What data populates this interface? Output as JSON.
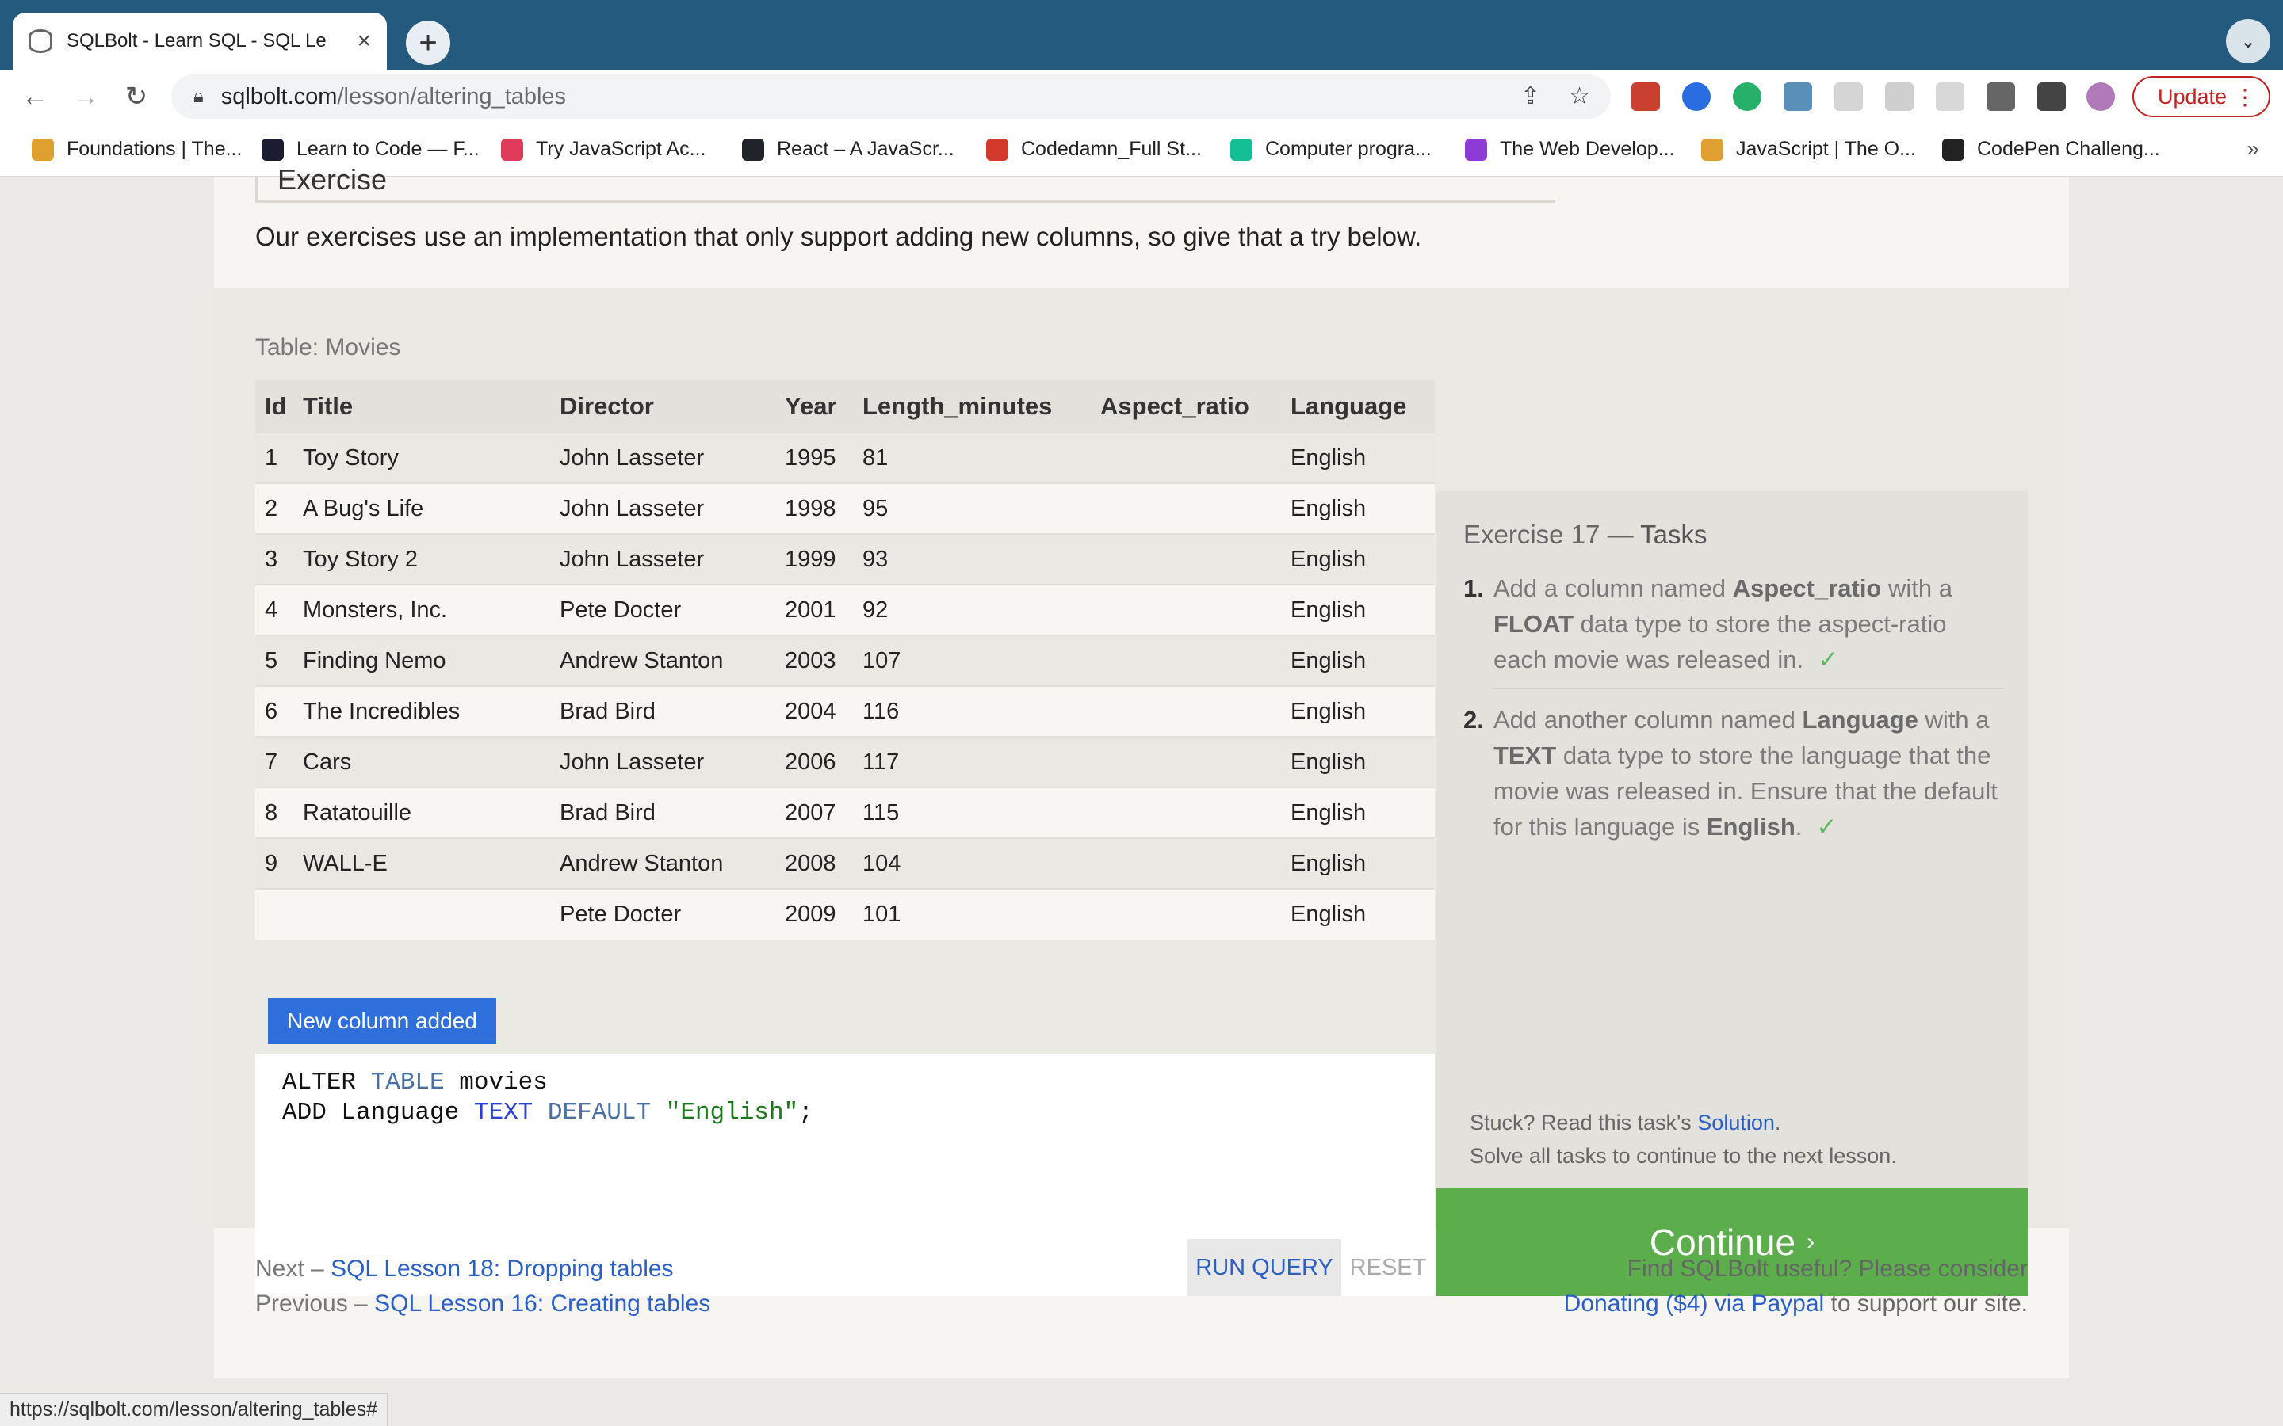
{
  "browser": {
    "tab_title": "SQLBolt - Learn SQL - SQL Le",
    "new_tab": "+",
    "url_host": "sqlbolt.com",
    "url_path": "/lesson/altering_tables",
    "update_label": "Update",
    "bookmarks": [
      {
        "label": "Foundations | The...",
        "color": "#e0a030"
      },
      {
        "label": "Learn to Code — F...",
        "color": "#1b1b32"
      },
      {
        "label": "Try JavaScript Ac...",
        "color": "#e03a5a"
      },
      {
        "label": "React – A JavaScr...",
        "color": "#20232a"
      },
      {
        "label": "Codedamn_Full St...",
        "color": "#d33a2c"
      },
      {
        "label": "Computer progra...",
        "color": "#14bf96"
      },
      {
        "label": "The Web Develop...",
        "color": "#8e3ad6"
      },
      {
        "label": "JavaScript | The O...",
        "color": "#e0a030"
      },
      {
        "label": "CodePen Challeng...",
        "color": "#222222"
      }
    ],
    "status_url": "https://sqlbolt.com/lesson/altering_tables#"
  },
  "lesson": {
    "box_heading": "Exercise",
    "intro": "Our exercises use an implementation that only support adding new columns, so give that a try below."
  },
  "table": {
    "caption": "Table: Movies",
    "columns": [
      "Id",
      "Title",
      "Director",
      "Year",
      "Length_minutes",
      "Aspect_ratio",
      "Language"
    ],
    "rows": [
      [
        "1",
        "Toy Story",
        "John Lasseter",
        "1995",
        "81",
        "",
        "English"
      ],
      [
        "2",
        "A Bug's Life",
        "John Lasseter",
        "1998",
        "95",
        "",
        "English"
      ],
      [
        "3",
        "Toy Story 2",
        "John Lasseter",
        "1999",
        "93",
        "",
        "English"
      ],
      [
        "4",
        "Monsters, Inc.",
        "Pete Docter",
        "2001",
        "92",
        "",
        "English"
      ],
      [
        "5",
        "Finding Nemo",
        "Andrew Stanton",
        "2003",
        "107",
        "",
        "English"
      ],
      [
        "6",
        "The Incredibles",
        "Brad Bird",
        "2004",
        "116",
        "",
        "English"
      ],
      [
        "7",
        "Cars",
        "John Lasseter",
        "2006",
        "117",
        "",
        "English"
      ],
      [
        "8",
        "Ratatouille",
        "Brad Bird",
        "2007",
        "115",
        "",
        "English"
      ],
      [
        "9",
        "WALL-E",
        "Andrew Stanton",
        "2008",
        "104",
        "",
        "English"
      ],
      [
        "",
        "",
        "Pete Docter",
        "2009",
        "101",
        "",
        "English"
      ]
    ]
  },
  "toast": "New column added",
  "editor": {
    "line1": [
      "ALTER",
      "TABLE",
      "movies"
    ],
    "line2": [
      "ADD",
      "Language",
      "TEXT",
      "DEFAULT",
      "\"English\"",
      ";"
    ],
    "run_label": "RUN QUERY",
    "reset_label": "RESET"
  },
  "tasks": {
    "title_prefix": "Exercise 17 —",
    "title_suffix": "Tasks",
    "items": [
      {
        "num": "1.",
        "a": "Add a column named ",
        "b": "Aspect_ratio",
        "c": " with a ",
        "d": "FLOAT",
        "e": " data type to store the aspect-ratio each movie was released in.",
        "check": "✓"
      },
      {
        "num": "2.",
        "a": "Add another column named ",
        "b": "Language",
        "c": " with a ",
        "d": "TEXT",
        "e": " data type to store the language that the movie was released in. Ensure that the default for this language is ",
        "f": "English",
        "g": ".",
        "check": "✓"
      }
    ],
    "stuck_prefix": "Stuck? Read this task's ",
    "solution_link": "Solution",
    "stuck_suffix": ".",
    "solve_note": "Solve all tasks to continue to the next lesson.",
    "continue_label": "Continue",
    "continue_chevron": "›"
  },
  "footer": {
    "next_prefix": "Next –",
    "next_link": "SQL Lesson 18: Dropping tables",
    "prev_prefix": "Previous –",
    "prev_link": "SQL Lesson 16: Creating tables",
    "support_line1": "Find SQLBolt useful? Please consider",
    "donate_link": "Donating ($4) via Paypal",
    "support_suffix": " to support our site."
  },
  "colors": {
    "accent_link": "#2a5fc7",
    "continue_green": "#5cad4c",
    "toast_blue": "#2f6fdc",
    "tabstrip": "#235a7e"
  }
}
